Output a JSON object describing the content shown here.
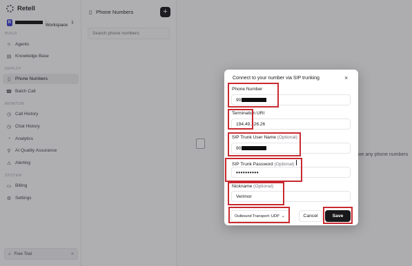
{
  "sidebar": {
    "brand": "Retell",
    "workspace": {
      "badge": "R",
      "name": ". Workspace"
    },
    "sections": {
      "build": "BUILD",
      "deploy": "DEPLOY",
      "monitor": "MONITOR",
      "system": "SYSTEM"
    },
    "items": [
      {
        "label": "Agents",
        "icon": "agents-icon"
      },
      {
        "label": "Knowledge Base",
        "icon": "knowledge-base-icon"
      },
      {
        "label": "Phone Numbers",
        "icon": "phone-icon",
        "active": true
      },
      {
        "label": "Batch Call",
        "icon": "batch-call-icon"
      },
      {
        "label": "Call History",
        "icon": "call-history-icon"
      },
      {
        "label": "Chat History",
        "icon": "chat-history-icon"
      },
      {
        "label": "Analytics",
        "icon": "analytics-icon"
      },
      {
        "label": "AI Quality Assurance",
        "icon": "quality-assurance-icon"
      },
      {
        "label": "Alerting",
        "icon": "alerting-icon"
      },
      {
        "label": "Billing",
        "icon": "billing-icon"
      },
      {
        "label": "Settings",
        "icon": "settings-icon"
      }
    ],
    "trial": "Free Trial"
  },
  "panel": {
    "title": "Phone Numbers",
    "add_label": "+",
    "search_placeholder": "Search phone numbers"
  },
  "main": {
    "empty_text": "'t have any phone numbers"
  },
  "modal": {
    "title": "Connect to your number via SIP trunking",
    "close": "×",
    "phone_number": {
      "label": "Phone Number",
      "value_prefix": "90"
    },
    "termination_uri": {
      "label": "Termination URI",
      "value": "194.49.126.26"
    },
    "sip_user": {
      "label": "SIP Trunk User Name",
      "optional": "(Optional)",
      "value_prefix": "90"
    },
    "sip_password": {
      "label": "SIP Trunk Password",
      "optional": "(Optional)",
      "value": "••••••••••"
    },
    "nickname": {
      "label": "Nickname",
      "optional": "(Optional)",
      "value": "Verimor"
    },
    "transport": "Outbound Transport: UDP",
    "cancel": "Cancel",
    "save": "Save"
  },
  "colors": {
    "annotation": "#c8282e",
    "primary": "#18181b"
  }
}
